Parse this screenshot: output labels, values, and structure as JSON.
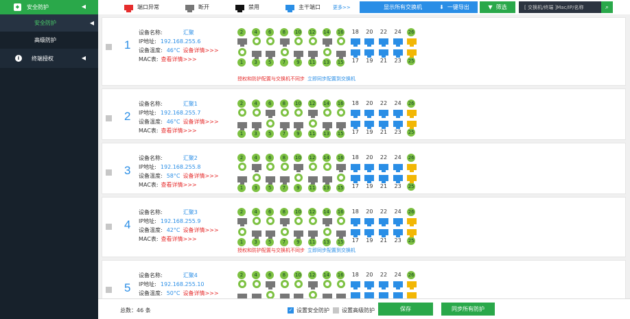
{
  "sidebar": {
    "top": {
      "label": "安全防护",
      "icon": "shield-icon"
    },
    "subs": [
      {
        "label": "安全防护"
      },
      {
        "label": "高级防护"
      }
    ],
    "main": {
      "label": "终端授权",
      "icon": "info-icon"
    }
  },
  "topbar": {
    "legend": [
      {
        "label": "端口异常",
        "color": "#e62d2d"
      },
      {
        "label": "断开",
        "color": "#777777"
      },
      {
        "label": "禁用",
        "color": "#111111"
      },
      {
        "label": "主干端口",
        "color": "#2a8ee6"
      }
    ],
    "more": "更多>>",
    "show_all": "显示所有交换机",
    "export": "一键导出",
    "filter": "筛选",
    "search_placeholder": "[ 交换机/终端 ]Mac/IP/名称"
  },
  "labels": {
    "name": "设备名称:",
    "ip": "IP地址:",
    "temp": "设备温度:",
    "mac": "MAC表:",
    "detail": "设备详情>>>",
    "view": "查看详情>>>",
    "sync_msg": "授权和防护配置与交换机不同步",
    "sync_link": "立即同步配置到交换机"
  },
  "switches": [
    {
      "num": "1",
      "name": "汇聚",
      "ip": "192.168.255.6",
      "temp": "46°C",
      "sync": true
    },
    {
      "num": "2",
      "name": "汇聚1",
      "ip": "192.168.255.7",
      "temp": "46°C",
      "sync": false
    },
    {
      "num": "3",
      "name": "汇聚2",
      "ip": "192.168.255.8",
      "temp": "58°C",
      "sync": false
    },
    {
      "num": "4",
      "name": "汇聚3",
      "ip": "192.168.255.9",
      "temp": "42°C",
      "sync": true
    },
    {
      "num": "5",
      "name": "汇聚4",
      "ip": "192.168.255.10",
      "temp": "50°C",
      "sync": false
    }
  ],
  "ports_top": [
    "2",
    "4",
    "6",
    "8",
    "10",
    "12",
    "14",
    "16",
    "18",
    "20",
    "22",
    "24",
    "26"
  ],
  "ports_bottom": [
    "1",
    "3",
    "5",
    "7",
    "9",
    "11",
    "13",
    "15",
    "17",
    "19",
    "21",
    "23",
    "25"
  ],
  "footer": {
    "total": "总数：46 条",
    "set_security": "设置安全防护",
    "set_advanced": "设置高级防护",
    "save": "保存",
    "sync_all": "同步所有防护"
  }
}
